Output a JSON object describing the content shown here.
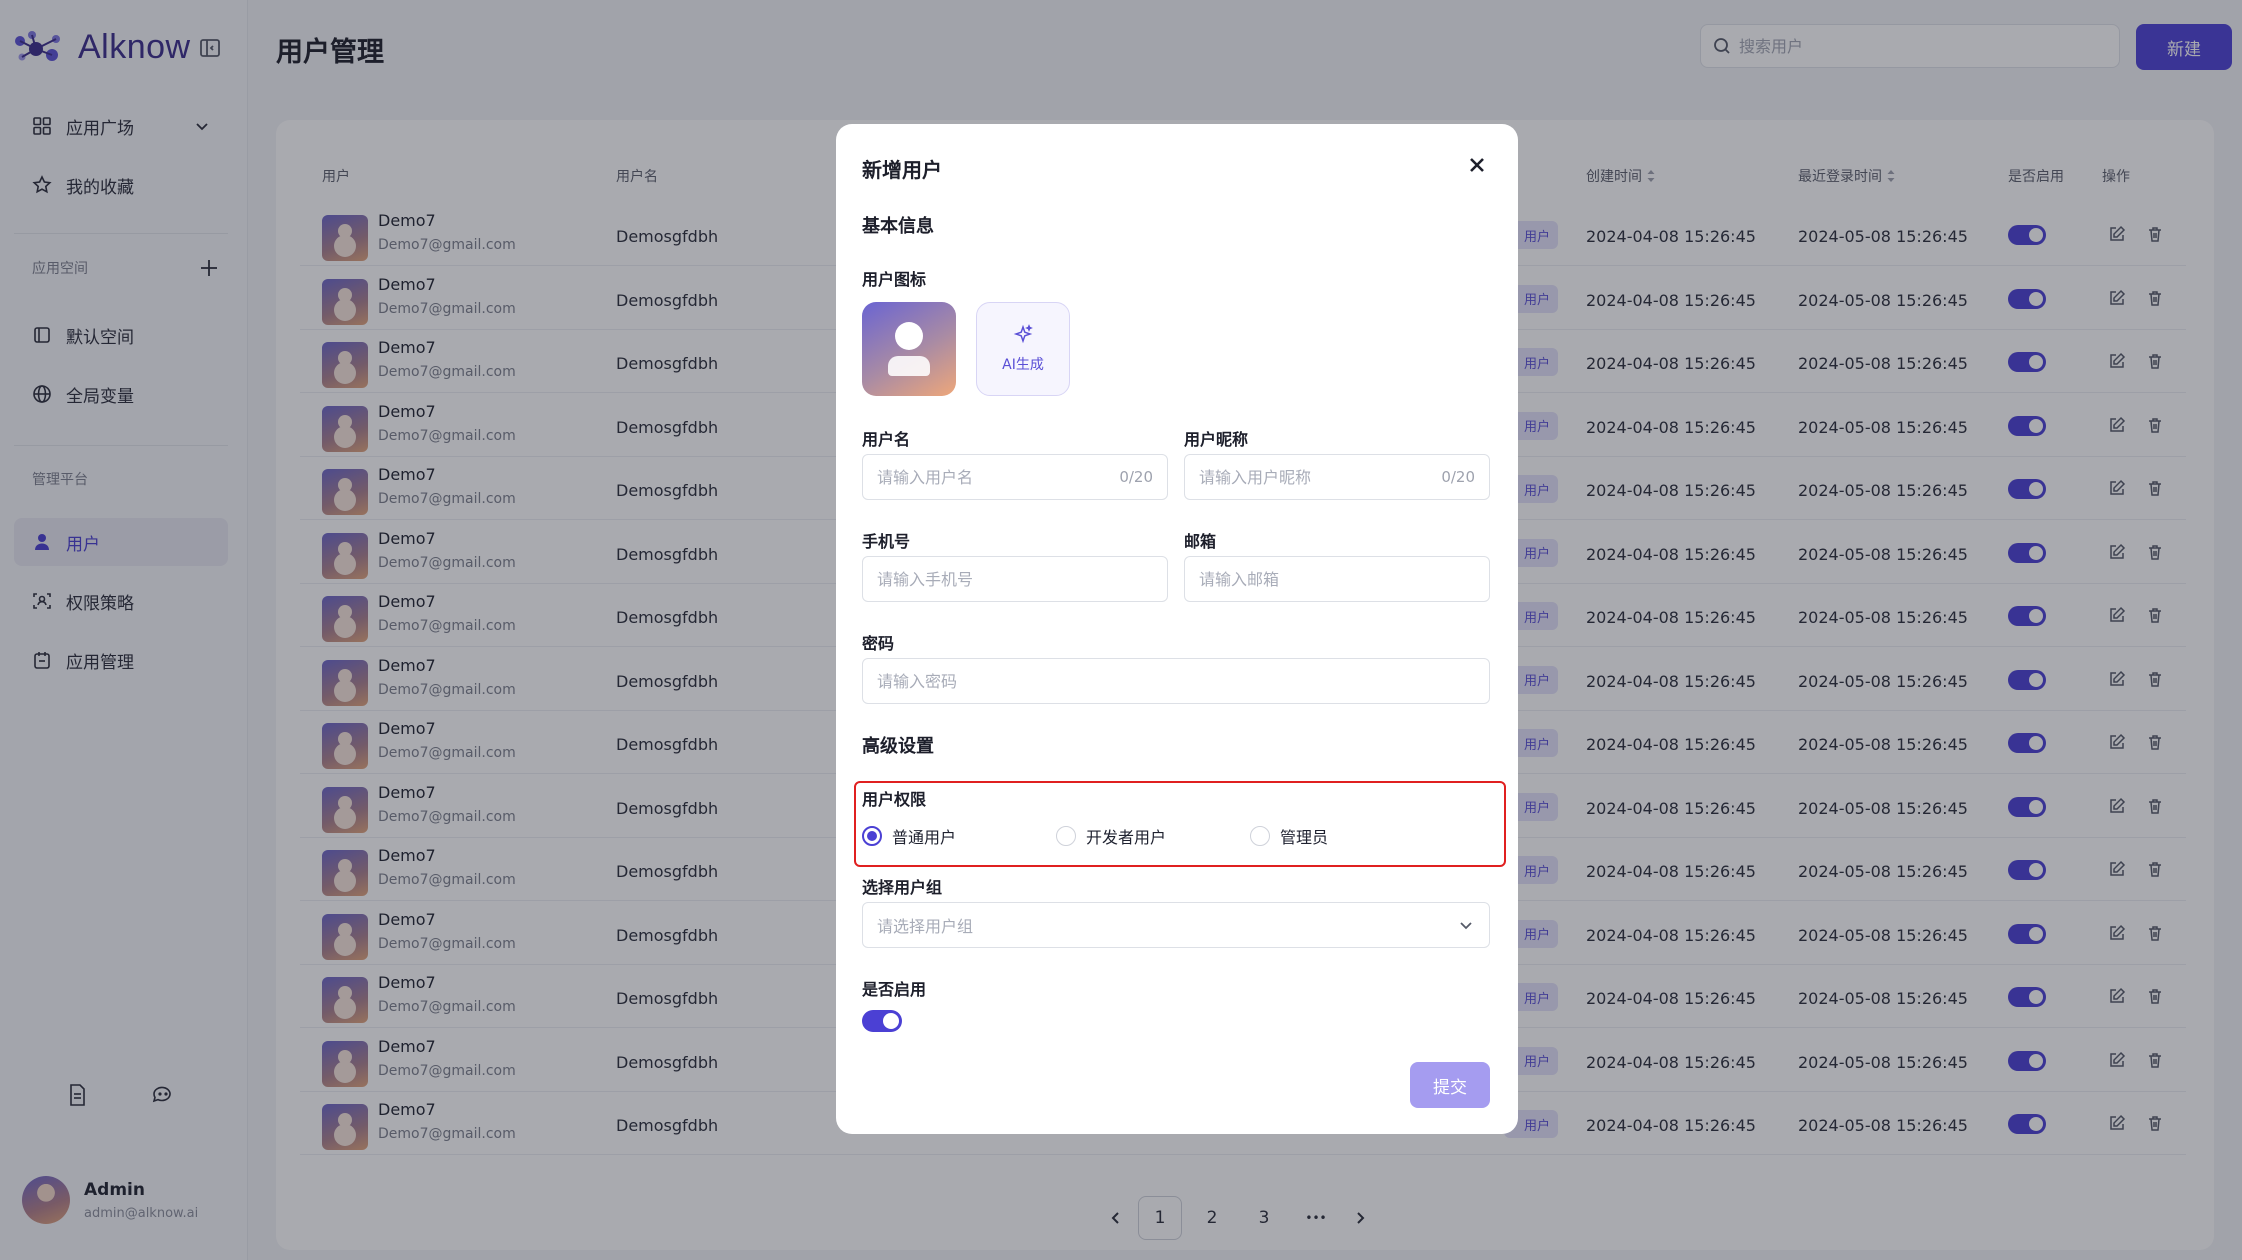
{
  "brand": {
    "name": "Alknow"
  },
  "sidebar": {
    "top_items": [
      {
        "label": "应用广场",
        "icon": "grid-icon"
      },
      {
        "label": "我的收藏",
        "icon": "star-icon"
      }
    ],
    "space_section": {
      "label": "应用空间",
      "items": [
        {
          "label": "默认空间",
          "icon": "space-icon"
        },
        {
          "label": "全局变量",
          "icon": "globe-icon"
        }
      ]
    },
    "admin_section": {
      "label": "管理平台",
      "items": [
        {
          "label": "用户",
          "icon": "user-icon",
          "active": true
        },
        {
          "label": "权限策略",
          "icon": "permission-icon"
        },
        {
          "label": "应用管理",
          "icon": "calendar-icon"
        }
      ]
    },
    "user": {
      "name": "Admin",
      "email": "admin@alknow.ai"
    }
  },
  "header": {
    "title": "用户管理",
    "search_placeholder": "搜索用户",
    "new_label": "新建"
  },
  "table": {
    "columns": [
      "用户",
      "用户名",
      "创建时间",
      "最近登录时间",
      "是否启用",
      "操作"
    ],
    "rows": [
      {
        "name": "Demo7",
        "email": "Demo7@gmail.com",
        "username": "Demosgfdbh",
        "role_badge": "用户",
        "created": "2024-04-08 15:26:45",
        "last_login": "2024-05-08 15:26:45",
        "enabled": true
      },
      {
        "name": "Demo7",
        "email": "Demo7@gmail.com",
        "username": "Demosgfdbh",
        "role_badge": "用户",
        "created": "2024-04-08 15:26:45",
        "last_login": "2024-05-08 15:26:45",
        "enabled": true
      },
      {
        "name": "Demo7",
        "email": "Demo7@gmail.com",
        "username": "Demosgfdbh",
        "role_badge": "用户",
        "created": "2024-04-08 15:26:45",
        "last_login": "2024-05-08 15:26:45",
        "enabled": true
      },
      {
        "name": "Demo7",
        "email": "Demo7@gmail.com",
        "username": "Demosgfdbh",
        "role_badge": "用户",
        "created": "2024-04-08 15:26:45",
        "last_login": "2024-05-08 15:26:45",
        "enabled": true
      },
      {
        "name": "Demo7",
        "email": "Demo7@gmail.com",
        "username": "Demosgfdbh",
        "role_badge": "用户",
        "created": "2024-04-08 15:26:45",
        "last_login": "2024-05-08 15:26:45",
        "enabled": true
      },
      {
        "name": "Demo7",
        "email": "Demo7@gmail.com",
        "username": "Demosgfdbh",
        "role_badge": "用户",
        "created": "2024-04-08 15:26:45",
        "last_login": "2024-05-08 15:26:45",
        "enabled": true
      },
      {
        "name": "Demo7",
        "email": "Demo7@gmail.com",
        "username": "Demosgfdbh",
        "role_badge": "用户",
        "created": "2024-04-08 15:26:45",
        "last_login": "2024-05-08 15:26:45",
        "enabled": true
      },
      {
        "name": "Demo7",
        "email": "Demo7@gmail.com",
        "username": "Demosgfdbh",
        "role_badge": "用户",
        "created": "2024-04-08 15:26:45",
        "last_login": "2024-05-08 15:26:45",
        "enabled": true
      },
      {
        "name": "Demo7",
        "email": "Demo7@gmail.com",
        "username": "Demosgfdbh",
        "role_badge": "用户",
        "created": "2024-04-08 15:26:45",
        "last_login": "2024-05-08 15:26:45",
        "enabled": true
      },
      {
        "name": "Demo7",
        "email": "Demo7@gmail.com",
        "username": "Demosgfdbh",
        "role_badge": "用户",
        "created": "2024-04-08 15:26:45",
        "last_login": "2024-05-08 15:26:45",
        "enabled": true
      },
      {
        "name": "Demo7",
        "email": "Demo7@gmail.com",
        "username": "Demosgfdbh",
        "role_badge": "用户",
        "created": "2024-04-08 15:26:45",
        "last_login": "2024-05-08 15:26:45",
        "enabled": true
      },
      {
        "name": "Demo7",
        "email": "Demo7@gmail.com",
        "username": "Demosgfdbh",
        "role_badge": "用户",
        "created": "2024-04-08 15:26:45",
        "last_login": "2024-05-08 15:26:45",
        "enabled": true
      },
      {
        "name": "Demo7",
        "email": "Demo7@gmail.com",
        "username": "Demosgfdbh",
        "role_badge": "用户",
        "created": "2024-04-08 15:26:45",
        "last_login": "2024-05-08 15:26:45",
        "enabled": true
      },
      {
        "name": "Demo7",
        "email": "Demo7@gmail.com",
        "username": "Demosgfdbh",
        "role_badge": "用户",
        "created": "2024-04-08 15:26:45",
        "last_login": "2024-05-08 15:26:45",
        "enabled": true
      },
      {
        "name": "Demo7",
        "email": "Demo7@gmail.com",
        "username": "Demosgfdbh",
        "role_badge": "用户",
        "created": "2024-04-08 15:26:45",
        "last_login": "2024-05-08 15:26:45",
        "enabled": true
      }
    ]
  },
  "pagination": {
    "pages": [
      "1",
      "2",
      "3"
    ],
    "current": "1",
    "ellipsis": "•••"
  },
  "modal": {
    "title": "新增用户",
    "basic_section": "基本信息",
    "icon_label": "用户图标",
    "ai_label": "AI生成",
    "username": {
      "label": "用户名",
      "placeholder": "请输入用户名",
      "count": "0/20"
    },
    "nickname": {
      "label": "用户昵称",
      "placeholder": "请输入用户昵称",
      "count": "0/20"
    },
    "phone": {
      "label": "手机号",
      "placeholder": "请输入手机号"
    },
    "email": {
      "label": "邮箱",
      "placeholder": "请输入邮箱"
    },
    "password": {
      "label": "密码",
      "placeholder": "请输入密码"
    },
    "advanced_section": "高级设置",
    "permission": {
      "label": "用户权限",
      "options": [
        "普通用户",
        "开发者用户",
        "管理员"
      ],
      "selected": "普通用户"
    },
    "group": {
      "label": "选择用户组",
      "placeholder": "请选择用户组"
    },
    "enabled": {
      "label": "是否启用",
      "value": true
    },
    "submit_label": "提交"
  },
  "colors": {
    "accent": "#4B40D4",
    "highlight_border": "#E02020",
    "submit_disabled": "#A59CF0"
  }
}
